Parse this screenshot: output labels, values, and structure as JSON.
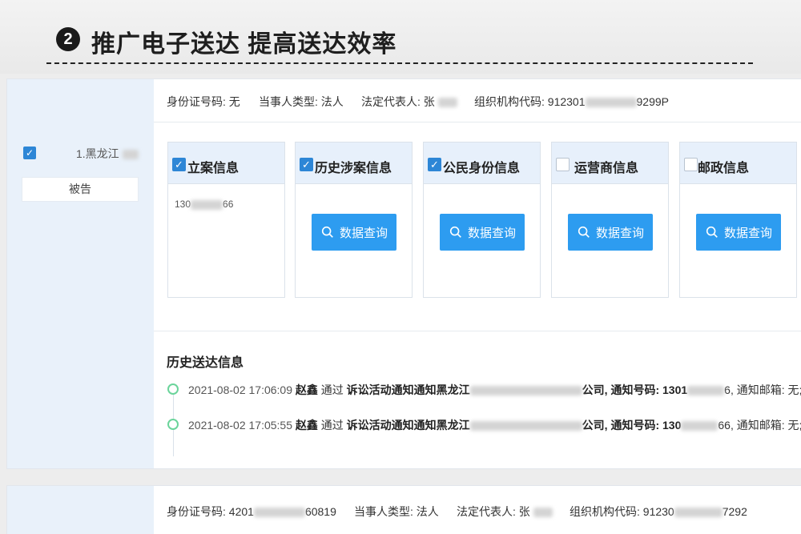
{
  "header": {
    "step_number": "2",
    "title": "推广电子送达 提高送达效率"
  },
  "party": {
    "name": "1.黑龙江",
    "role": "被告",
    "checked": true
  },
  "info": {
    "id_number": "身份证号码: 无",
    "party_type": "当事人类型: 法人",
    "legal_rep": "法定代表人: 张",
    "org_code_prefix": "组织机构代码: 912301",
    "org_code_suffix": "9299P"
  },
  "query_boxes": [
    {
      "label": "立案信息",
      "checked": true,
      "value_prefix": "130",
      "value_suffix": "66"
    },
    {
      "label": "历史涉案信息",
      "checked": true,
      "button": "数据查询"
    },
    {
      "label": "公民身份信息",
      "checked": true,
      "button": "数据查询"
    },
    {
      "label": "运营商信息",
      "checked": false,
      "button": "数据查询"
    },
    {
      "label": "邮政信息",
      "checked": false,
      "button": "数据查询"
    }
  ],
  "history": {
    "title": "历史送达信息",
    "items": [
      {
        "time": "2021-08-02 17:06:09",
        "person": "赵鑫",
        "via": "通过",
        "method": "诉讼活动通知",
        "notify": "通知黑龙江",
        "tail": "公司, 通知号码: 1301",
        "tail2": "6, 通知邮箱: 无;"
      },
      {
        "time": "2021-08-02 17:05:55",
        "person": "赵鑫",
        "via": "通过",
        "method": "诉讼活动通知",
        "notify": "通知黑龙江",
        "tail": "公司, 通知号码: 130",
        "tail2": "66, 通知邮箱: 无;"
      }
    ]
  },
  "info2": {
    "id_number_prefix": "身份证号码: 4201",
    "id_number_suffix": "60819",
    "party_type": "当事人类型: 法人",
    "legal_rep": "法定代表人: 张",
    "org_code_prefix": "组织机构代码: 91230",
    "org_code_suffix": "7292"
  },
  "colors": {
    "accent": "#2d86d6",
    "button": "#2d9cf0",
    "panel_bg": "#e9f1fa",
    "timeline_dot": "#6bd49b"
  }
}
